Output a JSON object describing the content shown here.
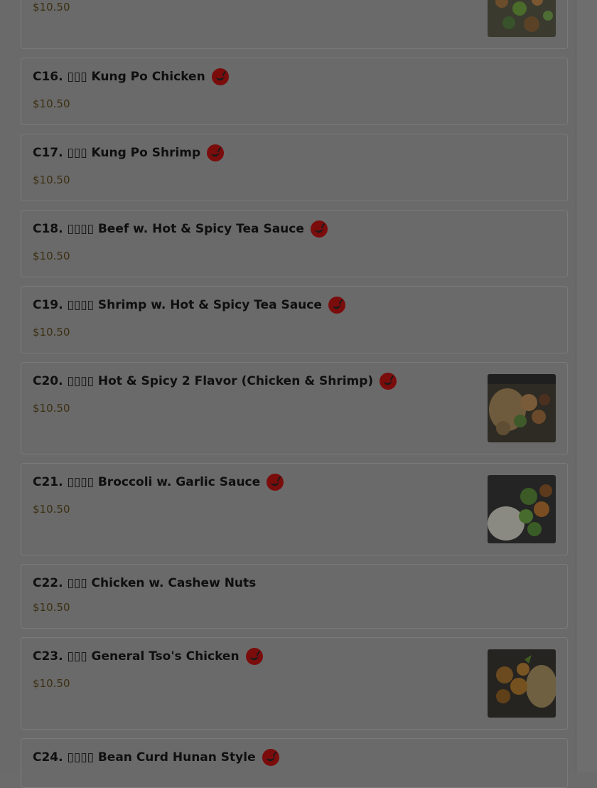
{
  "menu_items": [
    {
      "name": "",
      "price": "$10.50",
      "spicy": false,
      "photo": true
    },
    {
      "name": "C16. ▯▯▯ Kung Po Chicken",
      "price": "$10.50",
      "spicy": true,
      "photo": false
    },
    {
      "name": "C17. ▯▯▯ Kung Po Shrimp",
      "price": "$10.50",
      "spicy": true,
      "photo": false
    },
    {
      "name": "C18. ▯▯▯▯ Beef w. Hot & Spicy Tea Sauce",
      "price": "$10.50",
      "spicy": true,
      "photo": false
    },
    {
      "name": "C19. ▯▯▯▯ Shrimp w. Hot & Spicy Tea Sauce",
      "price": "$10.50",
      "spicy": true,
      "photo": false
    },
    {
      "name": "C20. ▯▯▯▯ Hot & Spicy 2 Flavor (Chicken & Shrimp)",
      "price": "$10.50",
      "spicy": true,
      "photo": true
    },
    {
      "name": "C21. ▯▯▯▯ Broccoli w. Garlic Sauce",
      "price": "$10.50",
      "spicy": true,
      "photo": true
    },
    {
      "name": "C22. ▯▯▯ Chicken w. Cashew Nuts",
      "price": "$10.50",
      "spicy": false,
      "photo": false
    },
    {
      "name": "C23. ▯▯▯ General Tso's Chicken",
      "price": "$10.50",
      "spicy": true,
      "photo": true
    },
    {
      "name": "C24. ▯▯▯▯ Bean Curd Hunan Style",
      "price": "",
      "spicy": true,
      "photo": false
    }
  ],
  "icons": {
    "spicy": "chili-pepper-icon"
  },
  "colors": {
    "overlay_background": "#6a6a6a",
    "card_border": "#7a7a7a",
    "title_text": "#0f0f0f",
    "price_text": "#3c2f12",
    "spicy_badge": "#7a0c0c"
  }
}
